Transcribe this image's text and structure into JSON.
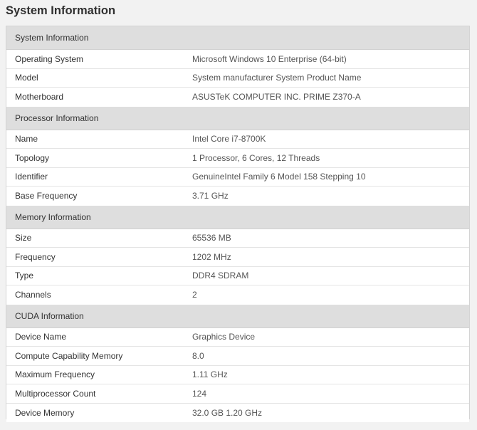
{
  "title": "System Information",
  "sections": [
    {
      "header": "System Information",
      "rows": [
        {
          "key": "Operating System",
          "value": "Microsoft Windows 10 Enterprise (64-bit)"
        },
        {
          "key": "Model",
          "value": "System manufacturer System Product Name"
        },
        {
          "key": "Motherboard",
          "value": "ASUSTeK COMPUTER INC. PRIME Z370-A"
        }
      ]
    },
    {
      "header": "Processor Information",
      "rows": [
        {
          "key": "Name",
          "value": "Intel Core i7-8700K"
        },
        {
          "key": "Topology",
          "value": "1 Processor, 6 Cores, 12 Threads"
        },
        {
          "key": "Identifier",
          "value": "GenuineIntel Family 6 Model 158 Stepping 10"
        },
        {
          "key": "Base Frequency",
          "value": "3.71 GHz"
        }
      ]
    },
    {
      "header": "Memory Information",
      "rows": [
        {
          "key": "Size",
          "value": "65536 MB"
        },
        {
          "key": "Frequency",
          "value": "1202 MHz"
        },
        {
          "key": "Type",
          "value": "DDR4 SDRAM"
        },
        {
          "key": "Channels",
          "value": "2"
        }
      ]
    },
    {
      "header": "CUDA Information",
      "rows": [
        {
          "key": "Device Name",
          "value": "Graphics Device"
        },
        {
          "key": "Compute Capability Memory",
          "value": "8.0"
        },
        {
          "key": "Maximum Frequency",
          "value": "1.11 GHz"
        },
        {
          "key": "Multiprocessor Count",
          "value": "124"
        },
        {
          "key": "Device Memory",
          "value": "32.0 GB 1.20 GHz"
        }
      ]
    }
  ]
}
